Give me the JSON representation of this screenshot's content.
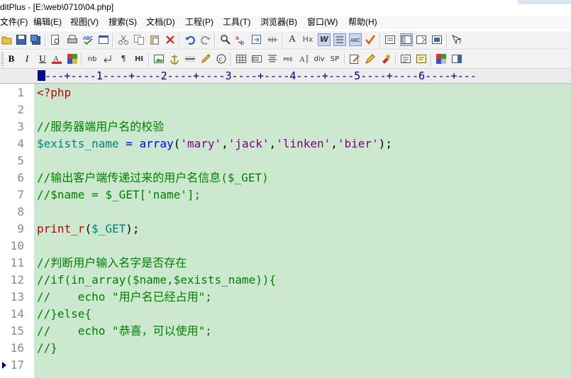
{
  "window": {
    "title": "ditPlus - [E:\\web\\0710\\04.php]"
  },
  "menu": [
    "文件(F)",
    "编辑(E)",
    "视图(V)",
    "搜索(S)",
    "文档(D)",
    "工程(P)",
    "工具(T)",
    "浏览器(B)",
    "窗口(W)",
    "帮助(H)"
  ],
  "toolbar2": {
    "bold": "B",
    "italic": "I",
    "underline": "U",
    "nb": "nb",
    "paragraph": "¶",
    "hi": "HI",
    "pre": "PRE",
    "div": "div",
    "sp": "SP",
    "a3": "A",
    "hx": "Hx",
    "w": "W",
    "abc": "ABC"
  },
  "ruler": "---+----1----+----2----+----3----+----4----+----5----+----6----+---",
  "colors": {
    "editor_bg": "#cce8cf",
    "comment": "#008000",
    "variable": "#008080",
    "string": "#800080",
    "keyword": "#0000ff",
    "function": "#c00000",
    "text": "#000000",
    "line_number": "#8a8a8a"
  },
  "lines": [
    {
      "num": "1",
      "tokens": [
        {
          "t": "<?php",
          "k": "function"
        }
      ]
    },
    {
      "num": "2",
      "tokens": []
    },
    {
      "num": "3",
      "tokens": [
        {
          "t": "//服务器端用户名的校验",
          "k": "comment"
        }
      ]
    },
    {
      "num": "4",
      "tokens": [
        {
          "t": "$exists_name",
          "k": "variable"
        },
        {
          "t": " = ",
          "k": "keyword"
        },
        {
          "t": "array",
          "k": "keyword"
        },
        {
          "t": "(",
          "k": "text"
        },
        {
          "t": "'mary'",
          "k": "string"
        },
        {
          "t": ",",
          "k": "text"
        },
        {
          "t": "'jack'",
          "k": "string"
        },
        {
          "t": ",",
          "k": "text"
        },
        {
          "t": "'linken'",
          "k": "string"
        },
        {
          "t": ",",
          "k": "text"
        },
        {
          "t": "'bier'",
          "k": "string"
        },
        {
          "t": ");",
          "k": "text"
        }
      ]
    },
    {
      "num": "5",
      "tokens": []
    },
    {
      "num": "6",
      "tokens": [
        {
          "t": "//输出客户端传递过来的用户名信息($_GET)",
          "k": "comment"
        }
      ]
    },
    {
      "num": "7",
      "tokens": [
        {
          "t": "//$name = $_GET['name'];",
          "k": "comment"
        }
      ]
    },
    {
      "num": "8",
      "tokens": []
    },
    {
      "num": "9",
      "tokens": [
        {
          "t": "print_r",
          "k": "function"
        },
        {
          "t": "(",
          "k": "text"
        },
        {
          "t": "$_GET",
          "k": "variable"
        },
        {
          "t": ");",
          "k": "text"
        }
      ]
    },
    {
      "num": "10",
      "tokens": []
    },
    {
      "num": "11",
      "tokens": [
        {
          "t": "//判断用户输入名字是否存在",
          "k": "comment"
        }
      ]
    },
    {
      "num": "12",
      "tokens": [
        {
          "t": "//if(in_array($name,$exists_name)){",
          "k": "comment"
        }
      ]
    },
    {
      "num": "13",
      "tokens": [
        {
          "t": "//    echo \"用户名已经占用\";",
          "k": "comment"
        }
      ]
    },
    {
      "num": "14",
      "tokens": [
        {
          "t": "//}else{",
          "k": "comment"
        }
      ]
    },
    {
      "num": "15",
      "tokens": [
        {
          "t": "//    echo \"恭喜，可以使用\";",
          "k": "comment"
        }
      ]
    },
    {
      "num": "16",
      "tokens": [
        {
          "t": "//}",
          "k": "comment"
        }
      ]
    },
    {
      "num": "17",
      "tokens": []
    }
  ]
}
